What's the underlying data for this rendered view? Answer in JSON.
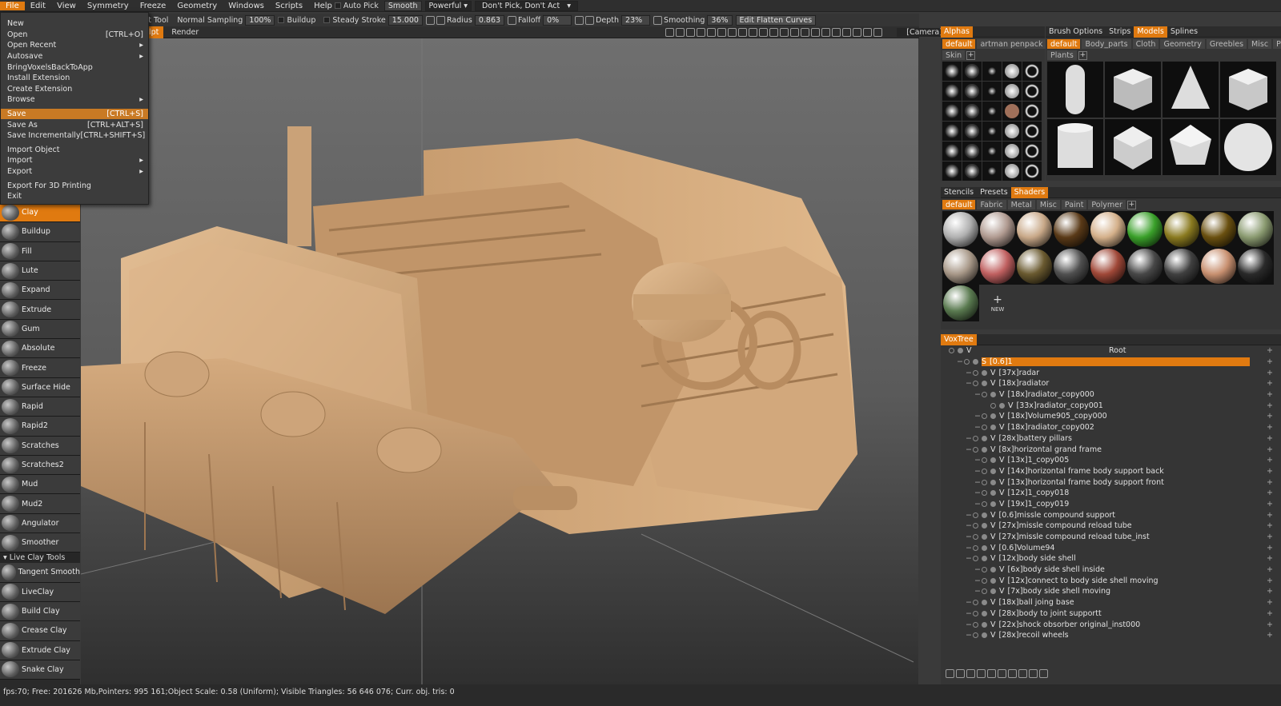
{
  "menubar": [
    "File",
    "Edit",
    "View",
    "Symmetry",
    "Freeze",
    "Geometry",
    "Windows",
    "Scripts",
    "Help"
  ],
  "toolbar1": {
    "auto_pick": "Auto Pick",
    "smooth": "Smooth",
    "powerful": "Powerful",
    "dont_pick": "Don't Pick, Don't Act"
  },
  "toolbar2": {
    "tool_label": "ct Tool",
    "sampling": "Normal Sampling",
    "sampling_val": "100%",
    "buildup": "Buildup",
    "steady": "Steady Stroke",
    "steady_val": "15.000",
    "radius": "Radius",
    "radius_val": "0.863",
    "falloff": "Falloff",
    "falloff_val": "0%",
    "depth": "Depth",
    "depth_val": "23%",
    "smoothing": "Smoothing",
    "smoothing_val": "36%",
    "flatten": "Edit Flatten Curves"
  },
  "rooms": {
    "sculpt": "lpt",
    "render": "Render",
    "camera": "[Camera]"
  },
  "file_menu": [
    {
      "label": "New",
      "shortcut": ""
    },
    {
      "label": "Open",
      "shortcut": "[CTRL+O]"
    },
    {
      "label": "Open Recent",
      "shortcut": "▸"
    },
    {
      "label": "Autosave",
      "shortcut": "▸"
    },
    {
      "label": "BringVoxelsBackToApp",
      "shortcut": ""
    },
    {
      "label": "Install Extension",
      "shortcut": ""
    },
    {
      "label": "Create Extension",
      "shortcut": ""
    },
    {
      "label": "Browse",
      "shortcut": "▸"
    },
    {
      "label": "Save",
      "shortcut": "[CTRL+S]"
    },
    {
      "label": "Save As",
      "shortcut": "[CTRL+ALT+S]"
    },
    {
      "label": "Save Incrementally",
      "shortcut": "[CTRL+SHIFT+S]"
    },
    {
      "label": "Import Object",
      "shortcut": ""
    },
    {
      "label": "Import",
      "shortcut": "▸"
    },
    {
      "label": "Export",
      "shortcut": "▸"
    },
    {
      "label": "Export For 3D Printing",
      "shortcut": ""
    },
    {
      "label": "Exit",
      "shortcut": ""
    }
  ],
  "tools": [
    "Clay",
    "Buildup",
    "Fill",
    "Lute",
    "Expand",
    "Extrude",
    "Gum",
    "Absolute",
    "Freeze",
    "Surface Hide",
    "Rapid",
    "Rapid2",
    "Scratches",
    "Scratches2",
    "Mud",
    "Mud2",
    "Angulator",
    "Smoother"
  ],
  "live_clay_header": "Live Clay Tools",
  "live_tools": [
    "Tangent Smooth",
    "LiveClay",
    "Build Clay",
    "Crease Clay",
    "Extrude Clay",
    "Snake Clay"
  ],
  "alphas_panel": {
    "title": "Alphas",
    "tabs": [
      "default",
      "artman penpack"
    ],
    "sub": "Skin"
  },
  "models_panel": {
    "tabs": [
      "Brush Options",
      "Strips",
      "Models",
      "Splines"
    ],
    "subtabs": [
      "default",
      "Body_parts",
      "Cloth",
      "Geometry",
      "Greebles",
      "Misc",
      "Parts"
    ],
    "sub2": "Plants"
  },
  "shaders_panel": {
    "tabs": [
      "Stencils",
      "Presets",
      "Shaders"
    ],
    "subtabs": [
      "default",
      "Fabric",
      "Metal",
      "Misc",
      "Paint",
      "Polymer"
    ],
    "new_label": "NEW"
  },
  "voxtree": {
    "title": "VoxTree",
    "root": "Root",
    "rows": [
      {
        "name": "[0.6]1",
        "level": 0,
        "sel": true,
        "prefix": "S"
      },
      {
        "name": "[37x]radar",
        "level": 1,
        "prefix": "V"
      },
      {
        "name": "[18x]radiator",
        "level": 1,
        "prefix": "V"
      },
      {
        "name": "[18x]radiator_copy000",
        "level": 2,
        "prefix": "V"
      },
      {
        "name": "[33x]radiator_copy001",
        "level": 3,
        "prefix": "V"
      },
      {
        "name": "[18x]Volume905_copy000",
        "level": 2,
        "prefix": "V"
      },
      {
        "name": "[18x]radiator_copy002",
        "level": 2,
        "prefix": "V"
      },
      {
        "name": "[28x]battery pillars",
        "level": 1,
        "prefix": "V"
      },
      {
        "name": "[8x]horizontal grand frame",
        "level": 1,
        "prefix": "V"
      },
      {
        "name": "[13x]1_copy005",
        "level": 2,
        "prefix": "V"
      },
      {
        "name": "[14x]horizontal frame body support back",
        "level": 2,
        "prefix": "V"
      },
      {
        "name": "[13x]horizontal frame body support front",
        "level": 2,
        "prefix": "V"
      },
      {
        "name": "[12x]1_copy018",
        "level": 2,
        "prefix": "V"
      },
      {
        "name": "[19x]1_copy019",
        "level": 2,
        "prefix": "V"
      },
      {
        "name": "[0.6]missle compound support",
        "level": 1,
        "prefix": "V"
      },
      {
        "name": "[27x]missle compound reload tube",
        "level": 1,
        "prefix": "V"
      },
      {
        "name": "[27x]missle compound reload tube_inst",
        "level": 1,
        "prefix": "V"
      },
      {
        "name": "[0.6]Volume94",
        "level": 1,
        "prefix": "V"
      },
      {
        "name": "[12x]body side shell",
        "level": 1,
        "prefix": "V"
      },
      {
        "name": "[6x]body side shell inside",
        "level": 2,
        "prefix": "V"
      },
      {
        "name": "[12x]connect to body side shell moving",
        "level": 2,
        "prefix": "V"
      },
      {
        "name": "[7x]body side shell moving",
        "level": 2,
        "prefix": "V"
      },
      {
        "name": "[18x]ball joing base",
        "level": 1,
        "prefix": "V"
      },
      {
        "name": "[28x]body to joint supportt",
        "level": 1,
        "prefix": "V"
      },
      {
        "name": "[22x]shock obsorber original_inst000",
        "level": 1,
        "prefix": "V"
      },
      {
        "name": "[28x]recoil wheels",
        "level": 1,
        "prefix": "V"
      }
    ]
  },
  "status": "fps:70;    Free: 201626 Mb,Pointers: 995 161;Object Scale: 0.58 (Uniform);  Visible Triangles: 56 646 076;  Curr. obj. tris: 0",
  "colors": {
    "accent": "#e07a10",
    "model": "#d7b088"
  }
}
